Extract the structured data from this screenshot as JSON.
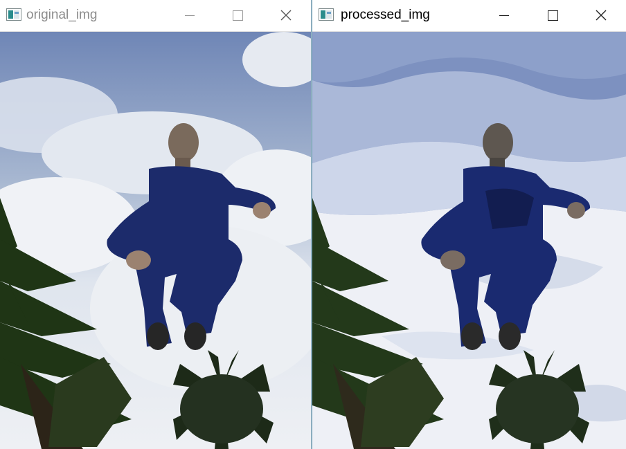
{
  "windows": [
    {
      "title": "original_img",
      "controls": {
        "minimize": "minimize-icon",
        "maximize": "maximize-icon",
        "close": "close-icon"
      },
      "image": {
        "subject": "person-jumping",
        "variant": "original"
      }
    },
    {
      "title": "processed_img",
      "controls": {
        "minimize": "minimize-icon",
        "maximize": "maximize-icon",
        "close": "close-icon"
      },
      "image": {
        "subject": "person-jumping",
        "variant": "posterized"
      }
    }
  ],
  "colors": {
    "sky_top": "#6e86b4",
    "cloud": "#eef1f5",
    "jacket": "#1a2a66",
    "palm": "#1e3214",
    "window_border": "#6aa1b7"
  }
}
